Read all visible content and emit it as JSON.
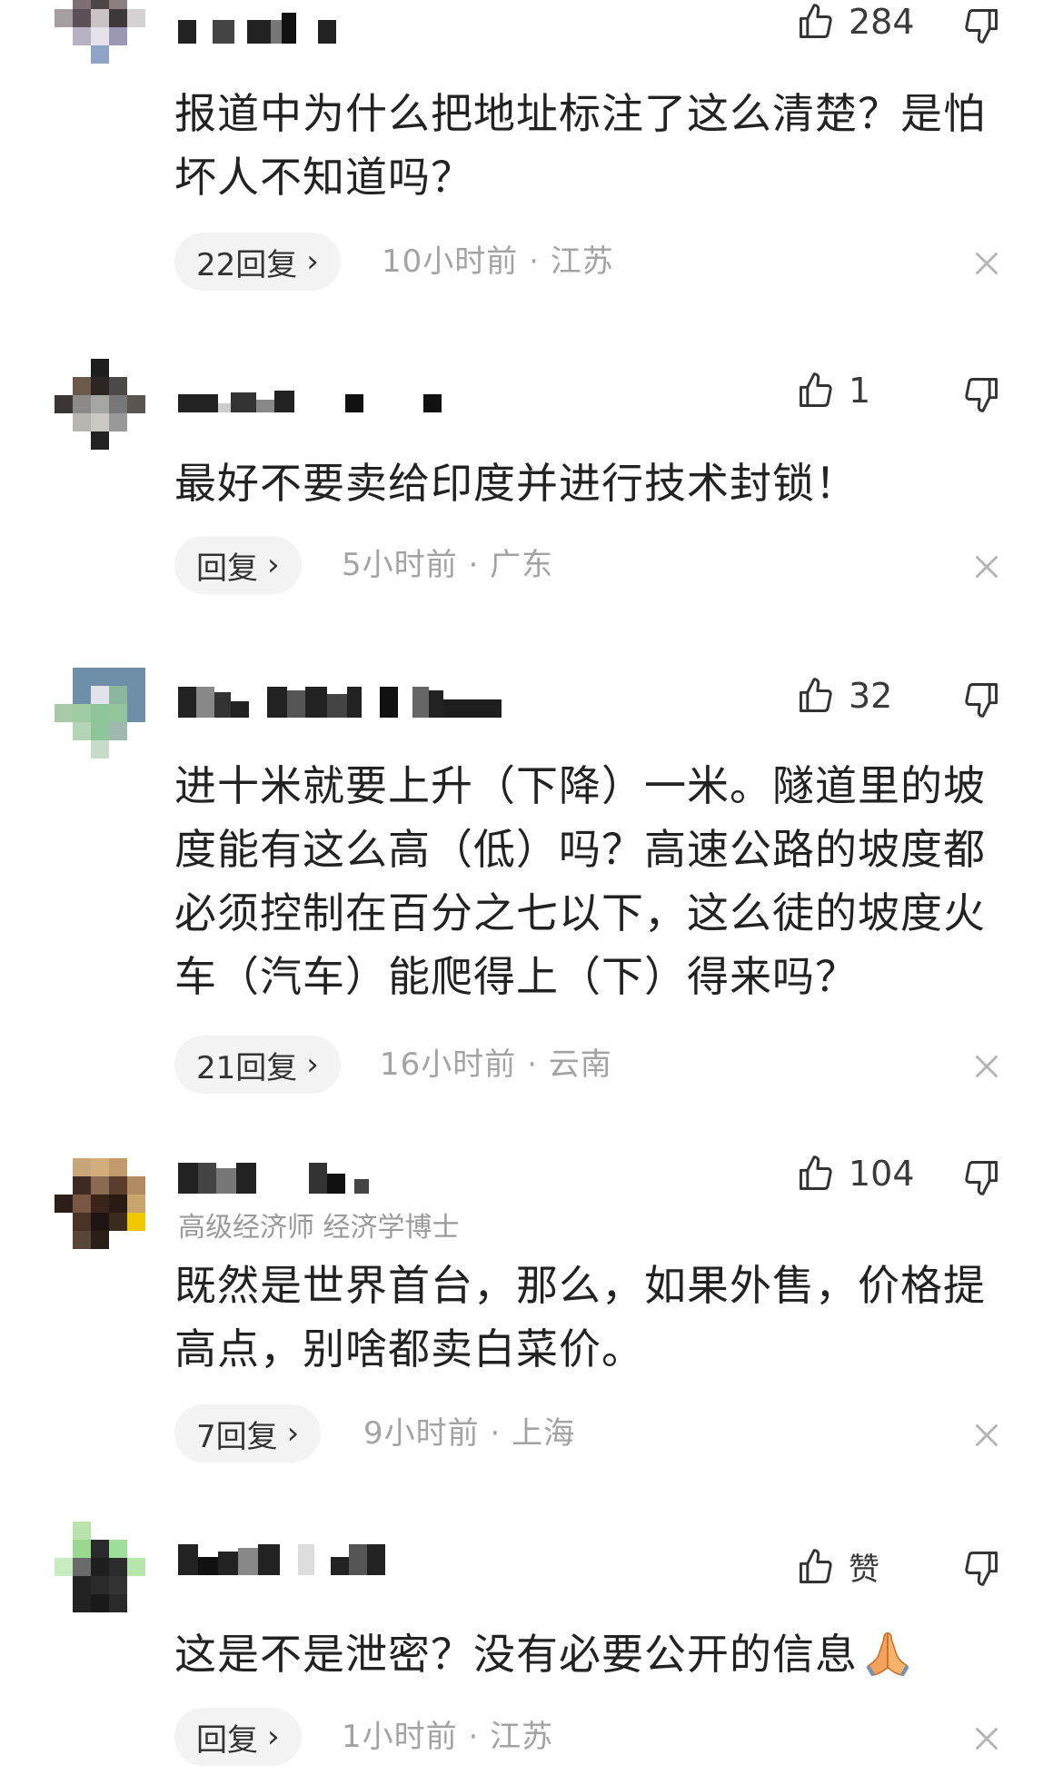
{
  "icons": {
    "like": "thumbs-up-icon",
    "dislike": "thumbs-down-icon",
    "close": "close-icon",
    "chevron": "chevron-right-icon",
    "emoji": "folded-hands-emoji"
  },
  "comments": [
    {
      "likes": "284",
      "text_lines": [
        "报道中为什么把地址标注了这么清楚？是怕",
        "坏人不知道吗？"
      ],
      "reply_label": "22回复",
      "time": "10小时前",
      "location": "江苏"
    },
    {
      "likes": "1",
      "text_lines": [
        "最好不要卖给印度并进行技术封锁！"
      ],
      "reply_label": "回复",
      "time": "5小时前",
      "location": "广东"
    },
    {
      "likes": "32",
      "text_lines": [
        "进十米就要上升（下降）一米。隧道里的坡",
        "度能有这么高（低）吗？高速公路的坡度都",
        "必须控制在百分之七以下，这么徒的坡度火",
        "车（汽车）能爬得上（下）得来吗？"
      ],
      "reply_label": "21回复",
      "time": "16小时前",
      "location": "云南"
    },
    {
      "likes": "104",
      "subtitle": "高级经济师 经济学博士",
      "text_lines": [
        "既然是世界首台，那么，如果外售，价格提",
        "高点，别啥都卖白菜价。"
      ],
      "reply_label": "7回复",
      "time": "9小时前",
      "location": "上海"
    },
    {
      "likes": "赞",
      "text_lines": [
        "这是不是泄密？没有必要公开的信息"
      ],
      "reply_label": "回复",
      "time": "1小时前",
      "location": "江苏"
    }
  ],
  "separator": " · "
}
